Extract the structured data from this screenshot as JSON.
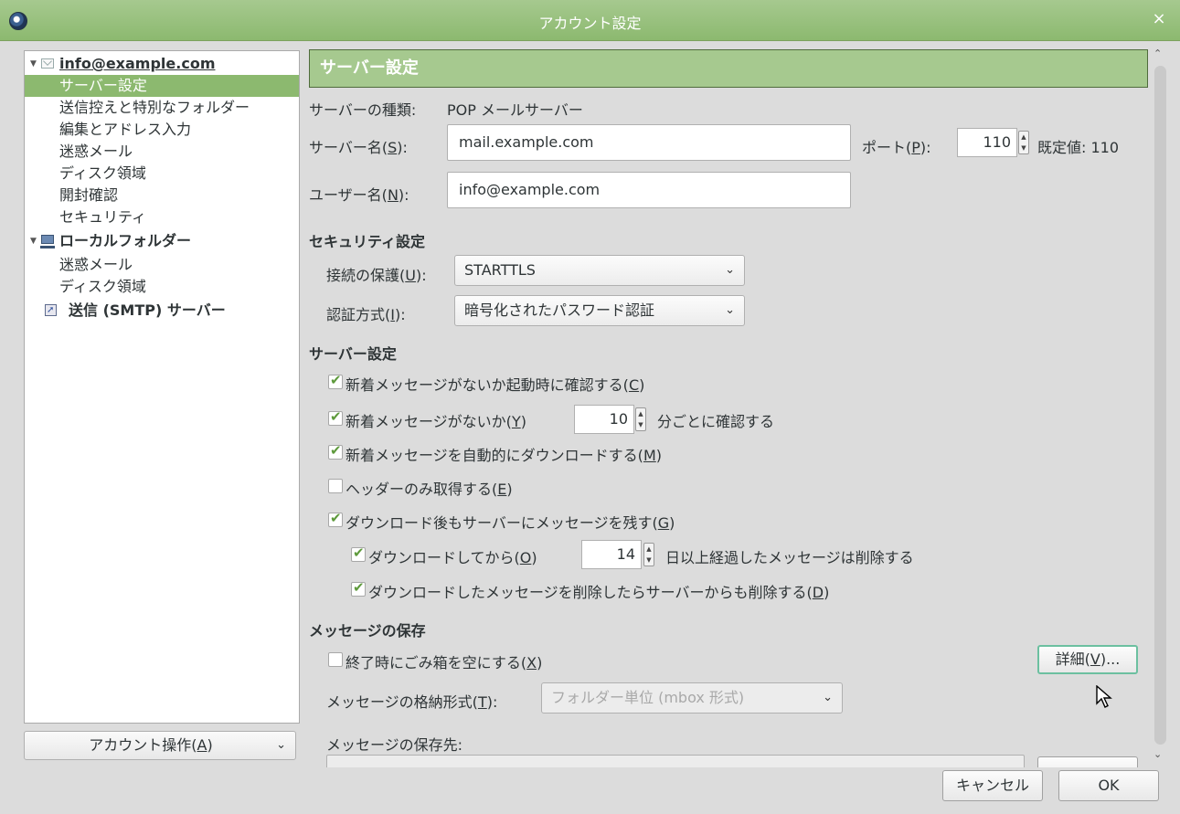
{
  "window": {
    "title": "アカウント設定",
    "close": "×"
  },
  "tree": {
    "items": [
      {
        "label": "info@example.com"
      },
      {
        "label": "サーバー設定"
      },
      {
        "label": "送信控えと特別なフォルダー"
      },
      {
        "label": "編集とアドレス入力"
      },
      {
        "label": "迷惑メール"
      },
      {
        "label": "ディスク領域"
      },
      {
        "label": "開封確認"
      },
      {
        "label": "セキュリティ"
      },
      {
        "label": "ローカルフォルダー"
      },
      {
        "label": "迷惑メール"
      },
      {
        "label": "ディスク領域"
      },
      {
        "label": "送信 (SMTP) サーバー"
      }
    ],
    "account_actions": {
      "label_pre": "アカウント操作(",
      "key": "A",
      "label_post": ")"
    }
  },
  "panel": {
    "header": "サーバー設定",
    "server_type_label": "サーバーの種類:",
    "server_type_value": "POP メールサーバー",
    "server_name": {
      "pre": "サーバー名(",
      "key": "S",
      "post": "):",
      "value": "mail.example.com"
    },
    "port": {
      "pre": "ポート(",
      "key": "P",
      "post": "):",
      "value": "110",
      "default_label": "既定値: 110"
    },
    "user_name": {
      "pre": "ユーザー名(",
      "key": "N",
      "post": "):",
      "value": "info@example.com"
    },
    "security_section": "セキュリティ設定",
    "connection": {
      "pre": "接続の保護(",
      "key": "U",
      "post": "):",
      "value": "STARTTLS"
    },
    "auth": {
      "pre": "認証方式(",
      "key": "I",
      "post": "):",
      "value": "暗号化されたパスワード認証"
    },
    "server_section": "サーバー設定",
    "check_startup": {
      "pre": "新着メッセージがないか起動時に確認する(",
      "key": "C",
      "post": ")",
      "checked": true
    },
    "check_every": {
      "pre": "新着メッセージがないか(",
      "key": "Y",
      "post": ")",
      "value": "10",
      "suffix": "分ごとに確認する",
      "checked": true
    },
    "auto_download": {
      "pre": "新着メッセージを自動的にダウンロードする(",
      "key": "M",
      "post": ")",
      "checked": true
    },
    "headers_only": {
      "pre": "ヘッダーのみ取得する(",
      "key": "E",
      "post": ")",
      "checked": false
    },
    "leave_on_server": {
      "pre": "ダウンロード後もサーバーにメッセージを残す(",
      "key": "G",
      "post": ")",
      "checked": true
    },
    "delete_after": {
      "pre": "ダウンロードしてから(",
      "key": "O",
      "post": ")",
      "value": "14",
      "suffix": "日以上経過したメッセージは削除する",
      "checked": true
    },
    "delete_when_deleted": {
      "pre": "ダウンロードしたメッセージを削除したらサーバーからも削除する(",
      "key": "D",
      "post": ")",
      "checked": true
    },
    "storage_section": "メッセージの保存",
    "empty_trash": {
      "pre": "終了時にごみ箱を空にする(",
      "key": "X",
      "post": ")",
      "checked": false
    },
    "advanced": {
      "pre": "詳細(",
      "key": "V",
      "post": ")..."
    },
    "store_type": {
      "pre": "メッセージの格納形式(",
      "key": "T",
      "post": "):",
      "value": "フォルダー単位 (mbox 形式)"
    },
    "store_location_label": "メッセージの保存先:"
  },
  "footer": {
    "cancel": "キャンセル",
    "ok": "OK"
  },
  "colors": {
    "accent": "#8cb96f",
    "header": "#a6c98f",
    "check": "#5e9a3c"
  }
}
